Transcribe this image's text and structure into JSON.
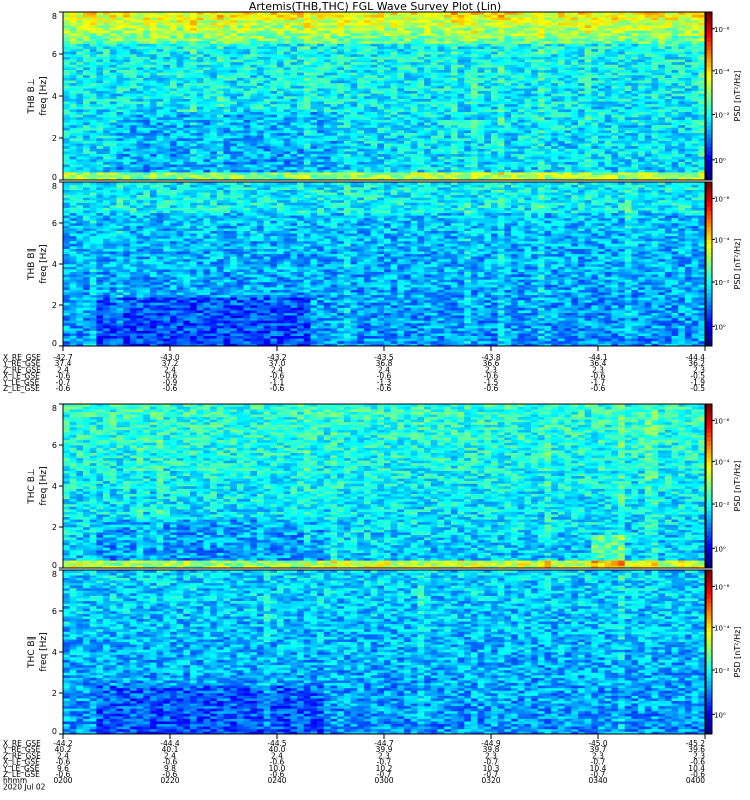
{
  "title": "Artemis(THB,THC) FGL Wave Survey Plot (Lin)",
  "colors": {
    "background": "#ffffff",
    "axis": "#000000"
  },
  "colorbar_ticks": [
    "10⁰",
    "10⁻²",
    "10⁻⁴",
    "10⁻⁶"
  ],
  "colorbar_label": "PSD [nT²/Hz]",
  "ylabel_freq": "freq [Hz]",
  "chart_data": [
    {
      "type": "heatmap",
      "panel_label": "THB B⊥",
      "ylabel": "freq [Hz]",
      "ylim": [
        0,
        8
      ],
      "yticks": [
        0,
        2,
        4,
        6,
        8
      ],
      "xlim": [
        "0200",
        "0400"
      ],
      "colorscale": "log PSD, 10^-6 to 10^1 nT²/Hz (jet)",
      "features": "strong enhancement 6.5–8 Hz; enhanced band below 0.3 Hz"
    },
    {
      "type": "heatmap",
      "panel_label": "THB B∥",
      "ylabel": "freq [Hz]",
      "ylim": [
        0,
        8
      ],
      "yticks": [
        0,
        2,
        4,
        6,
        8
      ],
      "xlim": [
        "0200",
        "0400"
      ],
      "colorscale": "log PSD, 10^-6 to 10^1 nT²/Hz (jet)",
      "features": "weak enhancement 6.5–8 Hz; lowest power 0–2 Hz near 0215–0245"
    },
    {
      "type": "heatmap",
      "panel_label": "THC B⊥",
      "ylabel": "freq [Hz]",
      "ylim": [
        0,
        8
      ],
      "yticks": [
        0,
        2,
        4,
        6,
        8
      ],
      "xlim": [
        "0200",
        "0400"
      ],
      "colorscale": "log PSD, 10^-6 to 10^1 nT²/Hz (jet)",
      "features": "moderate power 5–8 Hz; enhanced band below 0.3 Hz; bursts near 0350"
    },
    {
      "type": "heatmap",
      "panel_label": "THC B∥",
      "ylabel": "freq [Hz]",
      "ylim": [
        0,
        8
      ],
      "yticks": [
        0,
        2,
        4,
        6,
        8
      ],
      "xlim": [
        "0200",
        "0400"
      ],
      "colorscale": "log PSD, 10^-6 to 10^1 nT²/Hz (jet)",
      "features": "mostly weak; lowest power 0–2 Hz near 0210–0250"
    }
  ],
  "ephem_top": {
    "labels": [
      "X_RE_GSE",
      "Y_RE_GSE",
      "Z_RE_GSE",
      "X_LE_GSE",
      "Y_LE_GSE",
      "Z_LE_GSE"
    ],
    "columns": [
      [
        "-42.7",
        "37.4",
        "2.4",
        "-0.6",
        "-0.7",
        "-0.6"
      ],
      [
        "-43.0",
        "37.2",
        "2.4",
        "-0.6",
        "-0.9",
        "-0.6"
      ],
      [
        "-43.2",
        "37.0",
        "2.4",
        "-0.6",
        "-1.1",
        "-0.6"
      ],
      [
        "-43.5",
        "36.8",
        "2.4",
        "-0.6",
        "-1.3",
        "-0.6"
      ],
      [
        "-43.8",
        "36.6",
        "2.3",
        "-0.6",
        "-1.5",
        "-0.6"
      ],
      [
        "-44.1",
        "36.4",
        "2.3",
        "-0.6",
        "-1.7",
        "-0.6"
      ],
      [
        "-44.4",
        "36.2",
        "2.3",
        "-0.5",
        "-1.9",
        "-0.5"
      ]
    ]
  },
  "ephem_bottom": {
    "labels": [
      "X_RE_GSE",
      "Y_RE_GSE",
      "Z_RE_GSE",
      "X_LE_GSE",
      "Y_LE_GSE",
      "Z_LE_GSE",
      "hhmm",
      "2020 Jul 02"
    ],
    "columns": [
      [
        "-44.2",
        "40.2",
        "2.4",
        "-0.6",
        "9.6",
        "-0.6",
        "0200"
      ],
      [
        "-44.4",
        "40.1",
        "2.4",
        "-0.6",
        "9.8",
        "-0.6",
        "0220"
      ],
      [
        "-44.5",
        "40.0",
        "2.4",
        "-0.6",
        "10.0",
        "-0.6",
        "0240"
      ],
      [
        "-44.7",
        "39.9",
        "2.3",
        "-0.7",
        "10.2",
        "-0.7",
        "0300"
      ],
      [
        "-44.9",
        "39.8",
        "2.3",
        "-0.7",
        "10.3",
        "-0.7",
        "0320"
      ],
      [
        "-45.0",
        "39.7",
        "2.3",
        "-0.7",
        "10.4",
        "-0.7",
        "0340"
      ],
      [
        "-45.2",
        "39.6",
        "2.3",
        "-0.6",
        "10.4",
        "-0.6",
        "0400"
      ]
    ]
  }
}
